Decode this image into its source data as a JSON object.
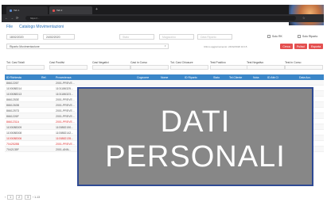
{
  "browser": {
    "tabs": [
      {
        "label": "Tab 1"
      },
      {
        "label": "Tab 2"
      }
    ],
    "url": "https://..."
  },
  "app": {
    "menu_label": "File",
    "breadcrumb": "Catalogo Movimentazioni"
  },
  "filters": {
    "date_from": "18/02/2020",
    "date_to": "24/02/2020",
    "filter3_placeholder": "Stato",
    "filter4_placeholder": "Magazzino",
    "filter5_placeholder": "Data Riparto",
    "checkbox1_label": "Solo RK",
    "checkbox2_label": "Solo Riparto",
    "report_select": "Riparto Movimentazione",
    "last_update": "Ultimo aggiornamento: 24/02/2020 10:15",
    "buttons": [
      "Cerca",
      "Pulisci",
      "Esporta"
    ]
  },
  "stats": [
    {
      "label": "Tot. Casi Totali",
      "value": ""
    },
    {
      "label": "Casi Positivi",
      "value": ""
    },
    {
      "label": "Casi Negativi",
      "value": ""
    },
    {
      "label": "Casi in Corso",
      "value": ""
    },
    {
      "label": "Tot. Casi Chiusure",
      "value": ""
    },
    {
      "label": "Test Positivo",
      "value": ""
    },
    {
      "label": "Test Negativo",
      "value": ""
    },
    {
      "label": "Test in Corso",
      "value": ""
    }
  ],
  "table": {
    "headers": [
      "ID Richiesta",
      "Ref.",
      "Provenienza",
      "Cognome",
      "Nome",
      "ID Riparto",
      "Stato",
      "Tel.Cliente",
      "Nota",
      "ID Attr.Ci",
      "Data Acc."
    ],
    "rows": [
      [
        "8661226T",
        "2001-PREVE..."
      ],
      [
        "1100088314",
        "1101186325..."
      ],
      [
        "1100088313",
        "1101186323..."
      ],
      [
        "8661253E",
        "2001-PREVE..."
      ],
      [
        "8661263B",
        "2001-PREVE..."
      ],
      [
        "8661257D",
        "2001-PREVE..."
      ],
      [
        "8661226F",
        "2001-PREVE..."
      ],
      [
        "8661231A",
        "2001-PREVE..."
      ],
      [
        "1100088309",
        "1100882150..."
      ],
      [
        "1100088308",
        "1100882142..."
      ],
      [
        "1100088306",
        "1100882135..."
      ],
      [
        "7042528B",
        "2001-PREVE..."
      ],
      [
        "7042135F",
        "2001-ANN..."
      ]
    ],
    "red_rows": [
      7,
      10,
      11
    ]
  },
  "pager": {
    "pages": [
      "1",
      "2",
      "3"
    ],
    "info": "1-13"
  },
  "privacy_overlay": {
    "line1": "DATI",
    "line2": "PERSONALI"
  },
  "colors": {
    "header_blue": "#3a86c8",
    "accent_red": "#e45050",
    "overlay_border": "#2e4a94"
  }
}
